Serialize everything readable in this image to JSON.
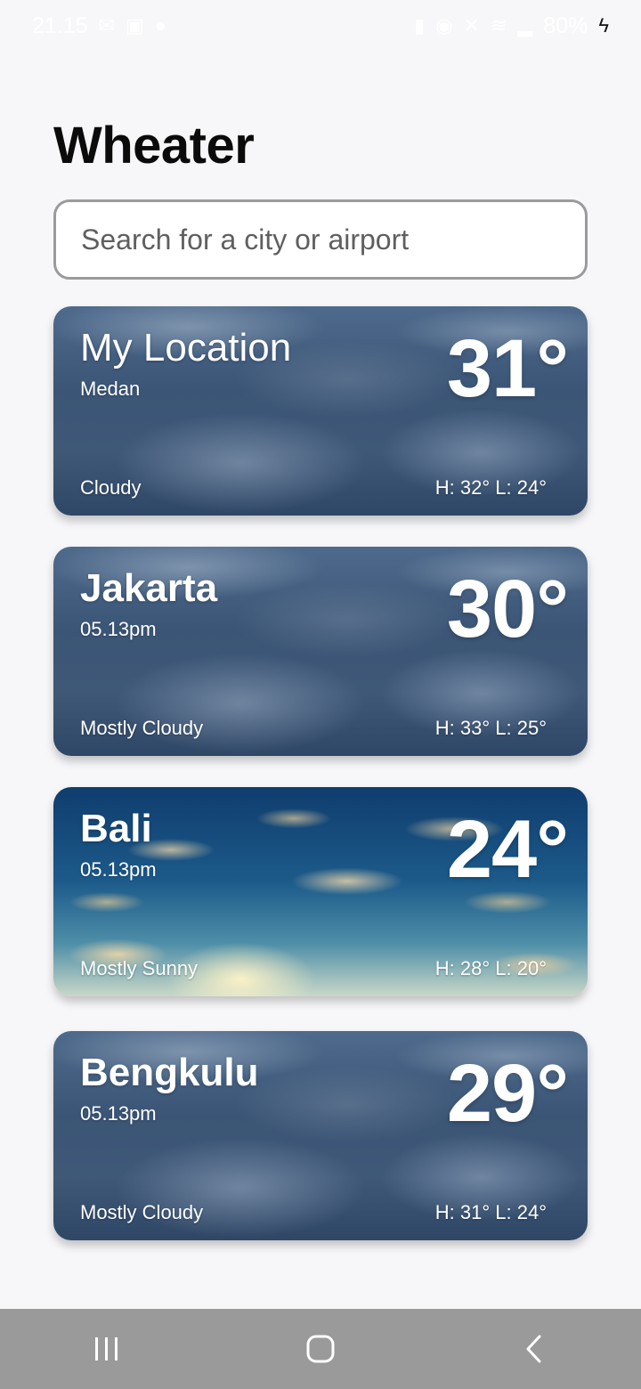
{
  "status_bar": {
    "time": "21.15",
    "battery": "80%",
    "icons_left": [
      "mail-icon",
      "message-icon",
      "notification-icon"
    ],
    "icons_right": [
      "lock-icon",
      "alarm-icon",
      "mute-icon",
      "volte-icon",
      "wifi-icon",
      "signal-icon",
      "charging-icon"
    ]
  },
  "app": {
    "title": "Wheater"
  },
  "search": {
    "placeholder": "Search for a city or airport"
  },
  "cards": [
    {
      "city": "My Location",
      "subtitle": "Medan",
      "temp": "31°",
      "condition": "Cloudy",
      "hilo": "H: 32° L: 24°",
      "background": "cloudy"
    },
    {
      "city": "Jakarta",
      "subtitle": "05.13pm",
      "temp": "30°",
      "condition": "Mostly Cloudy",
      "hilo": "H: 33° L: 25°",
      "background": "cloudy"
    },
    {
      "city": "Bali",
      "subtitle": "05.13pm",
      "temp": "24°",
      "condition": "Mostly Sunny",
      "hilo": "H: 28° L: 20°",
      "background": "sunny"
    },
    {
      "city": "Bengkulu",
      "subtitle": "05.13pm",
      "temp": "29°",
      "condition": "Mostly Cloudy",
      "hilo": "H: 31° L: 24°",
      "background": "cloudy"
    }
  ],
  "nav": {
    "buttons": [
      "recent-apps",
      "home",
      "back"
    ]
  },
  "colors": {
    "background": "#f7f7f9",
    "title": "#0b0b0b",
    "search_border": "#9b9b9b",
    "nav_bar": "#9a9a9a"
  }
}
